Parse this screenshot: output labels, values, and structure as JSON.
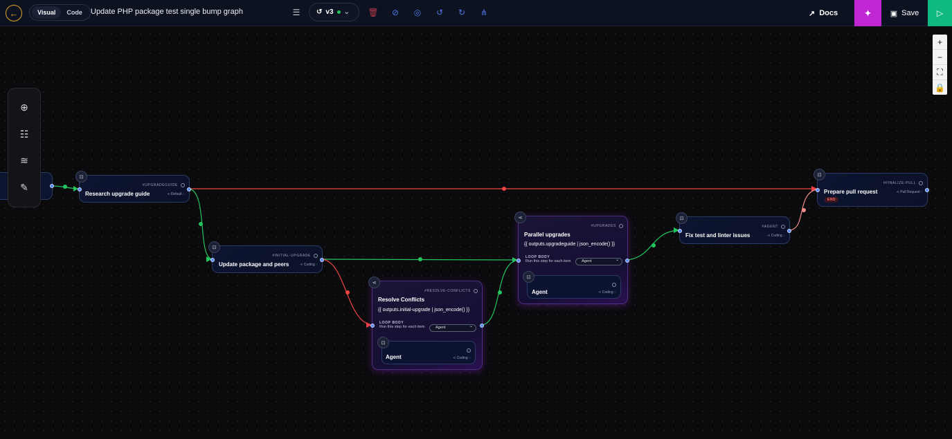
{
  "header": {
    "mode_visual": "Visual",
    "mode_code": "Code",
    "title": "Update PHP package test single bump graph",
    "version": "v3",
    "docs_label": "Docs",
    "save_label": "Save"
  },
  "colors": {
    "accent": "#e0a526",
    "ai": "#c026d3",
    "run": "#10b981",
    "edge_success": "#22c55e",
    "edge_failure": "#ef4444",
    "toolbar_icon": "#4f79e8"
  },
  "zoom_controls": [
    "+",
    "−",
    "⛶",
    "🔒"
  ],
  "side_toolbar": [
    "add-icon",
    "sliders-icon",
    "database-icon",
    "edit-icon"
  ],
  "nodes": {
    "upgradeguide": {
      "id": "#UPGRADEGUIDE",
      "title": "Research upgrade guide",
      "meta": "Default"
    },
    "initial_upgrade": {
      "id": "#INITIAL-UPGRADE",
      "title": "Update package and peers",
      "meta": "Coding"
    },
    "resolve_conflicts": {
      "id": "#RESOLVE-CONFLICTS",
      "title": "Resolve Conflicts",
      "expr": "{{ outputs.initial-upgrade | json_encode() }}",
      "loop_label": "LOOP BODY",
      "loop_desc": "Run this step for each item",
      "select": "Agent",
      "sub_title": "Agent",
      "sub_meta": "Coding"
    },
    "upgrades": {
      "id": "#UPGRADES",
      "title": "Parallel upgrades",
      "expr": "{{ outputs.upgradeguide | json_encode() }}",
      "loop_label": "LOOP BODY",
      "loop_desc": "Run this step for each item",
      "select": "Agent",
      "sub_title": "Agent",
      "sub_meta": "Coding"
    },
    "agent": {
      "id": "#AGENT",
      "title": "Fix test and linter issues",
      "meta": "Coding"
    },
    "finalize_pull": {
      "id": "#FINALIZE-PULL",
      "title": "Prepare pull request",
      "meta": "Pull Request",
      "end": "END"
    }
  }
}
